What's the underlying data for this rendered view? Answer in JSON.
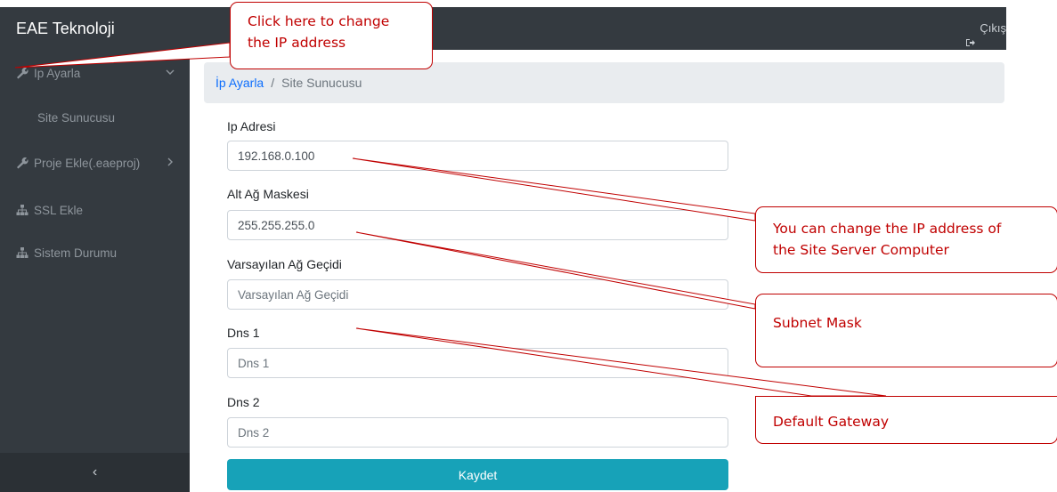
{
  "app": {
    "brand": "EAE Teknoloji",
    "logout_label": "Çıkış",
    "logout_icon": "sign-out-icon"
  },
  "sidebar": {
    "items": [
      {
        "label": "Ip Ayarla",
        "icon": "wrench-icon",
        "chevron": "chevron-down-icon"
      },
      {
        "label": "Site Sunucusu"
      },
      {
        "label": "Proje Ekle(.eaeproj)",
        "icon": "wrench-icon",
        "chevron": "chevron-right-icon"
      },
      {
        "label": "SSL Ekle",
        "icon": "sitemap-icon"
      },
      {
        "label": "Sistem Durumu",
        "icon": "sitemap-icon"
      }
    ],
    "collapse_label": "‹"
  },
  "breadcrumb": {
    "link": "İp Ayarla",
    "separator": "/",
    "current": "Site Sunucusu"
  },
  "form": {
    "ip_label": "Ip Adresi",
    "ip_value": "192.168.0.100",
    "mask_label": "Alt Ağ Maskesi",
    "mask_value": "255.255.255.0",
    "gateway_label": "Varsayılan Ağ Geçidi",
    "gateway_placeholder": "Varsayılan Ağ Geçidi",
    "dns1_label": "Dns 1",
    "dns1_placeholder": "Dns 1",
    "dns2_label": "Dns 2",
    "dns2_placeholder": "Dns 2",
    "save_label": "Kaydet"
  },
  "annotations": {
    "change_ip": [
      "Click here to change",
      "the IP address"
    ],
    "ip_server": [
      "You can change the IP address of",
      "the Site Server Computer"
    ],
    "subnet": [
      "Subnet Mask"
    ],
    "gateway": [
      "Default Gateway"
    ],
    "color": "#c00000"
  },
  "colors": {
    "sidebar": "#343a40",
    "accent_button": "#17a2b8",
    "link": "#0d6efd"
  }
}
